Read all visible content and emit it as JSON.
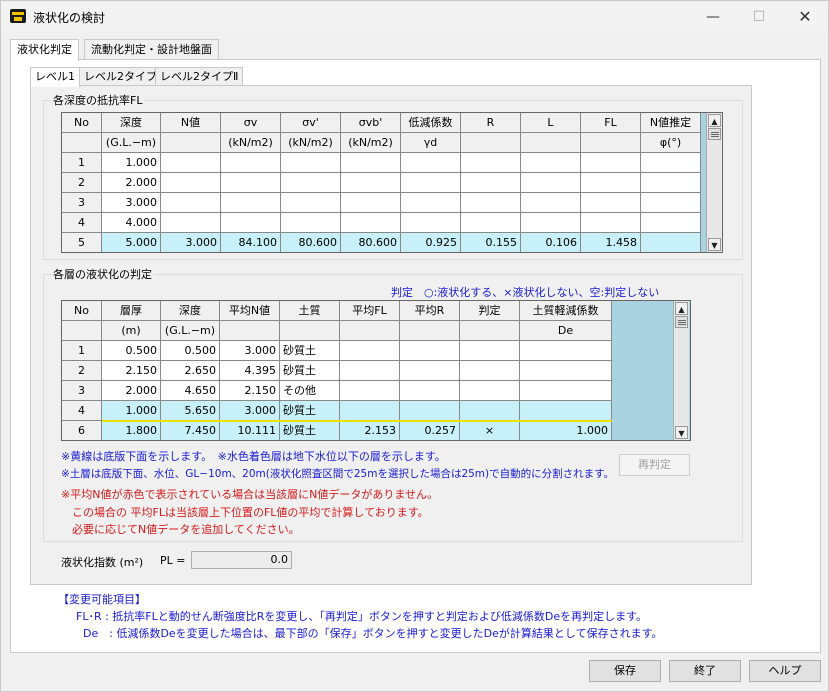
{
  "window": {
    "title": "液状化の検討",
    "min_icon": "minimize-icon",
    "max_icon": "maximize-icon",
    "close_icon": "close-icon"
  },
  "main_tabs": [
    {
      "label": "液状化判定"
    },
    {
      "label": "流動化判定・設計地盤面"
    }
  ],
  "sub_tabs": [
    {
      "label": "レベル1"
    },
    {
      "label": "レベル2タイプⅠ"
    },
    {
      "label": "レベル2タイプⅡ"
    }
  ],
  "fl_group": {
    "label": "各深度の抵抗率FL",
    "headers": [
      {
        "top": "No",
        "bottom": ""
      },
      {
        "top": "深度",
        "bottom": "(G.L.−m)"
      },
      {
        "top": "N値",
        "bottom": ""
      },
      {
        "top": "σv",
        "bottom": "(kN/m2)"
      },
      {
        "top": "σv'",
        "bottom": "(kN/m2)"
      },
      {
        "top": "σvb'",
        "bottom": "(kN/m2)"
      },
      {
        "top": "低減係数",
        "bottom": "γd"
      },
      {
        "top": "R",
        "bottom": ""
      },
      {
        "top": "L",
        "bottom": ""
      },
      {
        "top": "FL",
        "bottom": ""
      },
      {
        "top": "N値推定",
        "bottom": "φ(°)"
      }
    ],
    "rows": [
      {
        "no": "1",
        "cells": [
          "1.000",
          "",
          "",
          "",
          "",
          "",
          "",
          "",
          "",
          ""
        ]
      },
      {
        "no": "2",
        "cells": [
          "2.000",
          "",
          "",
          "",
          "",
          "",
          "",
          "",
          "",
          ""
        ]
      },
      {
        "no": "3",
        "cells": [
          "3.000",
          "",
          "",
          "",
          "",
          "",
          "",
          "",
          "",
          ""
        ]
      },
      {
        "no": "4",
        "cells": [
          "4.000",
          "",
          "",
          "",
          "",
          "",
          "",
          "",
          "",
          ""
        ]
      },
      {
        "no": "5",
        "cells": [
          "5.000",
          "3.000",
          "84.100",
          "80.600",
          "80.600",
          "0.925",
          "0.155",
          "0.106",
          "1.458",
          ""
        ]
      }
    ]
  },
  "layer_group": {
    "label": "各層の液状化の判定",
    "legend": "判定　○:液状化する、×液状化しない、空:判定しない",
    "headers": [
      {
        "top": "No",
        "bottom": ""
      },
      {
        "top": "層厚",
        "bottom": "(m)"
      },
      {
        "top": "深度",
        "bottom": "(G.L.−m)"
      },
      {
        "top": "平均N値",
        "bottom": ""
      },
      {
        "top": "土質",
        "bottom": ""
      },
      {
        "top": "平均FL",
        "bottom": ""
      },
      {
        "top": "平均R",
        "bottom": ""
      },
      {
        "top": "判定",
        "bottom": ""
      },
      {
        "top": "土質軽減係数",
        "bottom": "De"
      }
    ],
    "rows": [
      {
        "no": "1",
        "cells": [
          "0.500",
          "0.500",
          "3.000",
          "砂質土",
          "",
          "",
          "",
          ""
        ]
      },
      {
        "no": "2",
        "cells": [
          "2.150",
          "2.650",
          "4.395",
          "砂質土",
          "",
          "",
          "",
          ""
        ]
      },
      {
        "no": "3",
        "cells": [
          "2.000",
          "4.650",
          "2.150",
          "その他",
          "",
          "",
          "",
          ""
        ]
      },
      {
        "no": "4",
        "cells": [
          "1.000",
          "5.650",
          "3.000",
          "砂質土",
          "",
          "",
          "",
          ""
        ]
      },
      {
        "no": "6",
        "cells": [
          "1.800",
          "7.450",
          "10.111",
          "砂質土",
          "2.153",
          "0.257",
          "×",
          "1.000"
        ]
      }
    ],
    "notes": {
      "n1": "※黄線は底版下面を示します。　※水色着色層は地下水位以下の層を示します。",
      "n2": "※土層は底版下面、水位、GL−10m、20m(液状化照査区間で25mを選択した場合は25m)で自動的に分割されます。",
      "n3": "※平均N値が赤色で表示されている場合は当該層にN値データがありません。",
      "n4": "この場合の 平均FLは当該層上下位置のFL値の平均で計算しております。",
      "n5": "必要に応じてN値データを追加してください。"
    },
    "rejudge_button": "再判定"
  },
  "pl": {
    "label": "液状化指数 (m²)",
    "prefix": "PL =",
    "value": "0.0"
  },
  "changeable": {
    "title": "【変更可能項目】",
    "line1": "FL･R : 抵抗率FLと動的せん断強度比Rを変更し、「再判定」ボタンを押すと判定および低減係数Deを再判定します。",
    "line2": "De　: 低減係数Deを変更した場合は、最下部の「保存」ボタンを押すと変更したDeが計算結果として保存されます。"
  },
  "footer": {
    "save": "保存",
    "exit": "終了",
    "help": "ヘルプ"
  },
  "colors": {
    "water_row": "#c8f0f8",
    "bottom_line": "#e8e000",
    "note_blue": "#1a1ad6",
    "note_red": "#d61a1a",
    "grid_bg": "#a9d3e0"
  }
}
